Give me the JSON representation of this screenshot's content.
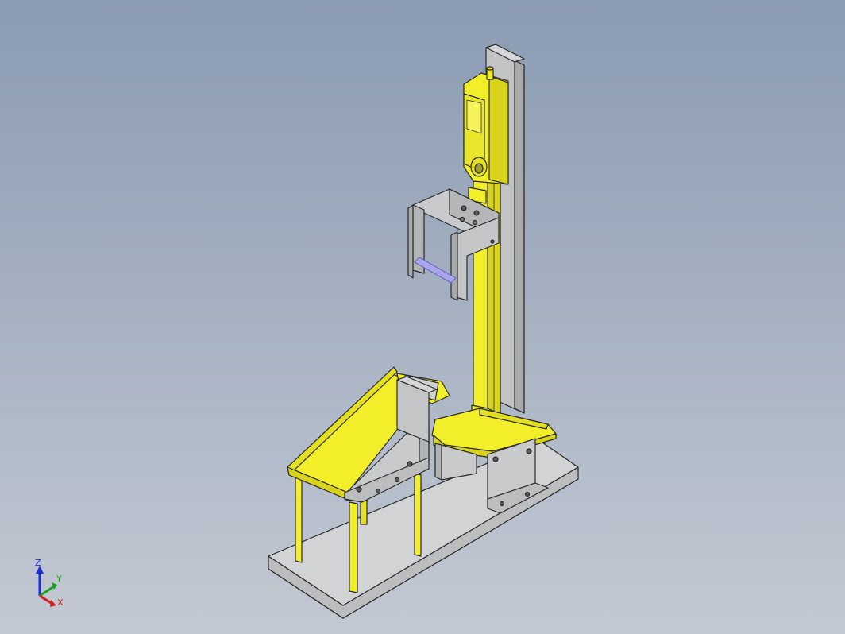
{
  "viewport": {
    "background_top": "#8a9bb2",
    "background_bottom": "#c3c9d3"
  },
  "model": {
    "colors": {
      "yellow": "#f2ef2a",
      "yellow_shade": "#d9d41a",
      "gray": "#c9cacc",
      "gray_shade": "#a8a9ab",
      "edge": "#2a2a2a",
      "rod": "#a9a6ee"
    }
  },
  "triad": {
    "z_label": "Z",
    "y_label": "Y",
    "x_label": "X",
    "z_color": "#1e2fd0",
    "y_color": "#1aa31a",
    "x_color": "#d0201e"
  }
}
